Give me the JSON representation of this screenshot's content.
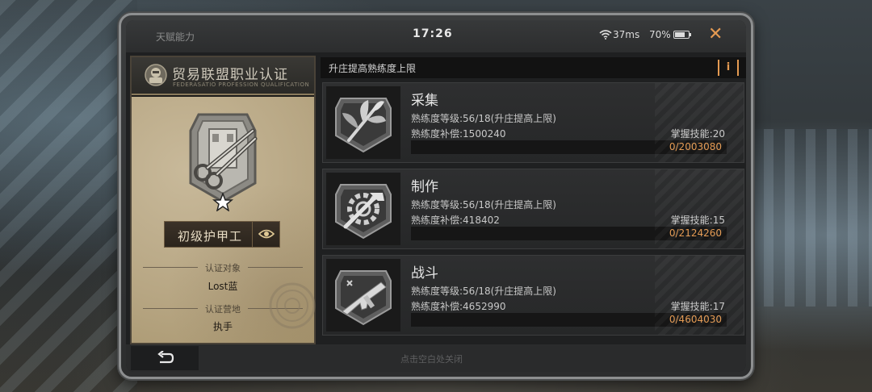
{
  "status": {
    "title": "天赋能力",
    "time": "17:26",
    "ping": "37ms",
    "battery": "70%",
    "close_icon": "close-icon"
  },
  "cert": {
    "title_cn": "贸易联盟职业认证",
    "title_en": "FEDERASATIO PROFESSION QUALIFICATION",
    "job": "初级护甲工",
    "target_label": "认证对象",
    "target_value": "Lost蓝",
    "camp_label": "认证营地",
    "camp_value": "执手"
  },
  "header": {
    "title": "升庄提高熟练度上限",
    "info": "i"
  },
  "skills": [
    {
      "name": "采集",
      "level": "熟练度等级:56/18(升庄提高上限)",
      "compensation": "熟练度补偿:1500240",
      "mastered": "掌握技能:20",
      "progress": "0/2003080",
      "fraction": 0,
      "icon": "gathering-icon"
    },
    {
      "name": "制作",
      "level": "熟练度等级:56/18(升庄提高上限)",
      "compensation": "熟练度补偿:418402",
      "mastered": "掌握技能:15",
      "progress": "0/2124260",
      "fraction": 0,
      "icon": "crafting-icon"
    },
    {
      "name": "战斗",
      "level": "熟练度等级:56/18(升庄提高上限)",
      "compensation": "熟练度补偿:4652990",
      "mastered": "掌握技能:17",
      "progress": "0/4604030",
      "fraction": 0,
      "icon": "combat-icon"
    }
  ],
  "footer": {
    "hint": "点击空白处关闭"
  },
  "colors": {
    "accent": "#e49a52",
    "parchment": "#b7a683"
  }
}
